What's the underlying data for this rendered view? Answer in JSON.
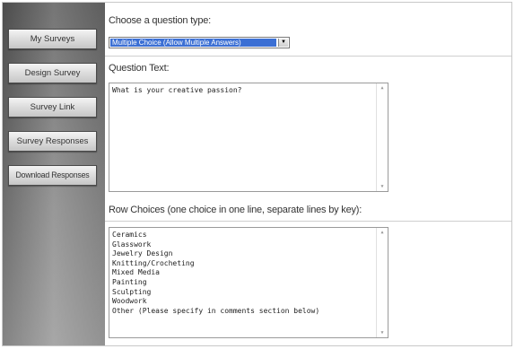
{
  "sidebar": {
    "items": [
      {
        "label": "My Surveys"
      },
      {
        "label": "Design Survey"
      },
      {
        "label": "Survey Link"
      },
      {
        "label": "Survey Responses"
      },
      {
        "label": "Download Responses"
      }
    ]
  },
  "main": {
    "question_type_label": "Choose a question type:",
    "question_type_value": "Multiple Choice (Allow Multiple Answers)",
    "question_text_label": "Question Text:",
    "question_text_value": "What is your creative passion?",
    "row_choices_label": "Row Choices (one choice in one line, separate lines by key):",
    "row_choices": [
      "Ceramics",
      "Glasswork",
      "Jewelry Design",
      "Knitting/Crocheting",
      "Mixed Media",
      "Painting",
      "Sculpting",
      "Woodwork",
      "Other (Please specify in comments section below)"
    ]
  },
  "icons": {
    "select_arrow": "dropdown-arrow-icon",
    "scroll_up": "scroll-up-arrow-icon",
    "scroll_down": "scroll-down-arrow-icon"
  },
  "colors": {
    "selected_option_bg": "#3b6fd4",
    "sidebar_dark": "#5a5a5a"
  }
}
